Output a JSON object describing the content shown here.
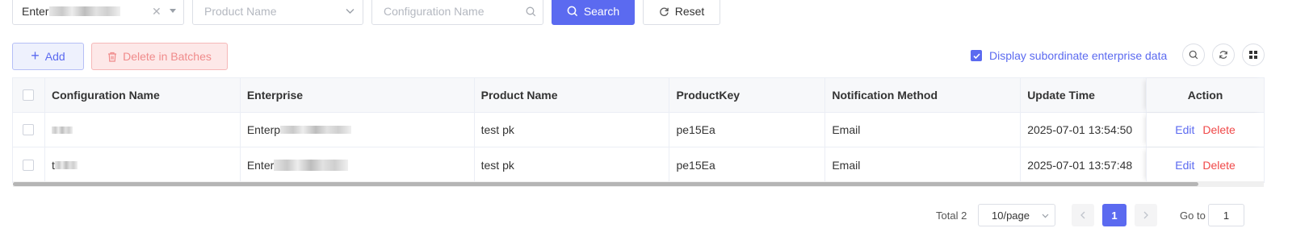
{
  "filters": {
    "enterprise_value": "Enter",
    "product_placeholder": "Product Name",
    "config_placeholder": "Configuration Name",
    "search_label": "Search",
    "reset_label": "Reset"
  },
  "toolbar": {
    "add_label": "Add",
    "delete_batch_label": "Delete in Batches",
    "subordinate_label": "Display subordinate enterprise data",
    "subordinate_checked": true
  },
  "table": {
    "columns": [
      "Configuration Name",
      "Enterprise",
      "Product Name",
      "ProductKey",
      "Notification Method",
      "Update Time",
      "Action"
    ],
    "rows": [
      {
        "config_name": "",
        "enterprise": "Enterp",
        "product_name": "test pk",
        "product_key": "pe15Ea",
        "method": "Email",
        "update_time": "2025-07-01 13:54:50",
        "edit": "Edit",
        "delete": "Delete"
      },
      {
        "config_name": "t",
        "enterprise": "Enter",
        "product_name": "test pk",
        "product_key": "pe15Ea",
        "method": "Email",
        "update_time": "2025-07-01 13:57:48",
        "edit": "Edit",
        "delete": "Delete"
      }
    ]
  },
  "pagination": {
    "total_label": "Total 2",
    "page_size": "10/page",
    "current_page": "1",
    "goto_label": "Go to",
    "goto_value": "1"
  },
  "colors": {
    "primary": "#5b6af0",
    "danger": "#f04848"
  }
}
